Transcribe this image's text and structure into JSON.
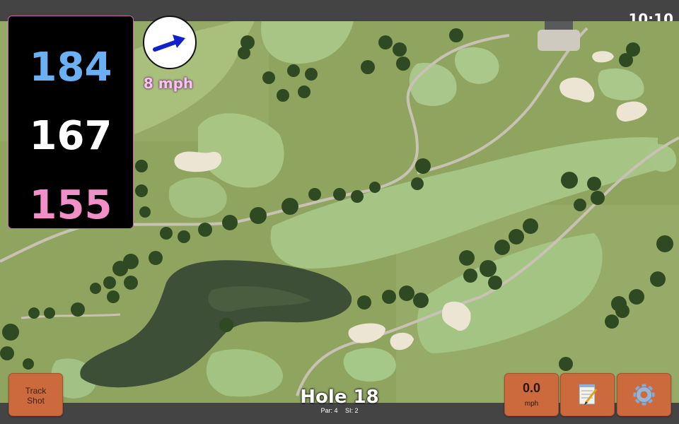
{
  "status_bar": {
    "time": "10:10"
  },
  "yardages": {
    "back": "184",
    "center": "167",
    "front": "155"
  },
  "wind": {
    "speed_label": "8 mph",
    "direction_icon": "wind-arrow-icon"
  },
  "track_button": {
    "line1": "Track",
    "line2": "Shot"
  },
  "speed_button": {
    "value": "0.0",
    "unit": "mph"
  },
  "notes_button": {
    "icon": "notepad-icon"
  },
  "settings_button": {
    "icon": "gear-icon"
  },
  "hole": {
    "title": "Hole 18",
    "par": "Par: 4",
    "si": "SI: 2"
  },
  "colors": {
    "back": "#6bb0f5",
    "center": "#ffffff",
    "front": "#f08fc8",
    "button": "#cc6a3d",
    "wind_label": "#f3c5ee"
  }
}
